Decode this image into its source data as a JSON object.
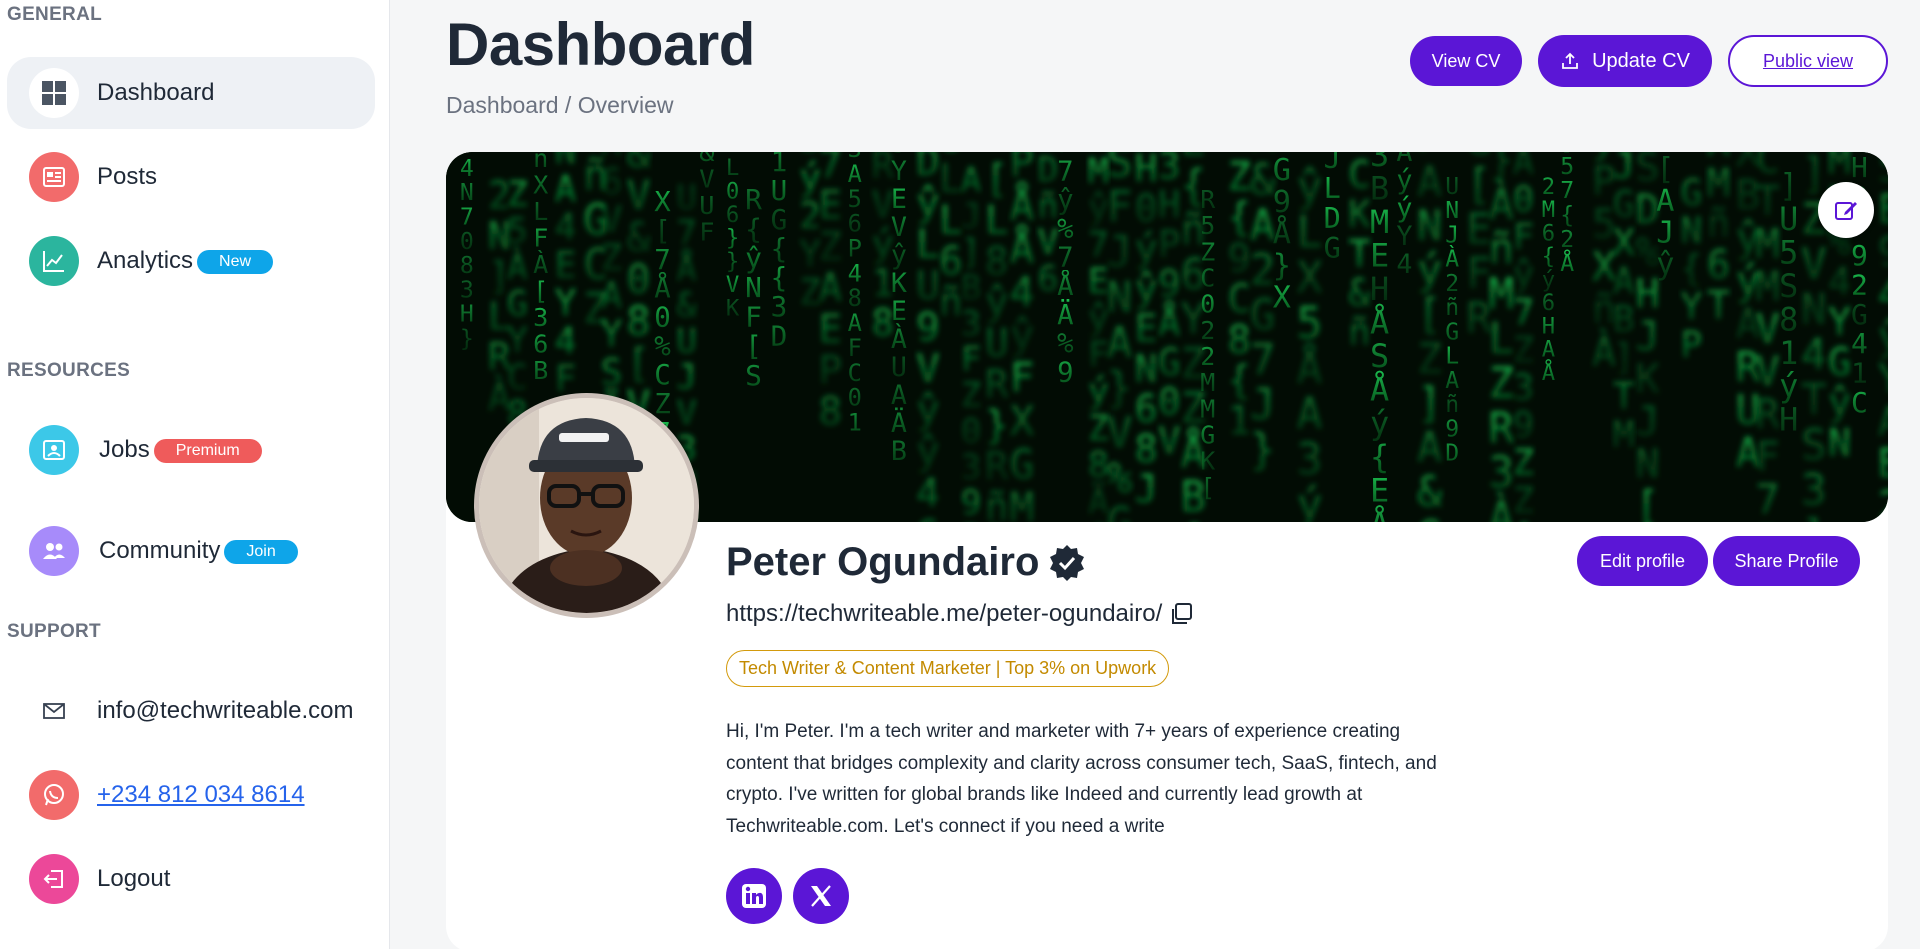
{
  "sidebar": {
    "general_title": "GENERAL",
    "resources_title": "RESOURCES",
    "support_title": "SUPPORT",
    "items": [
      {
        "label": "Dashboard",
        "icon": "dashboard-grid-icon"
      },
      {
        "label": "Posts",
        "icon": "newspaper-icon",
        "color": "#f26b6b"
      },
      {
        "label": "Analytics",
        "icon": "chart-line-icon",
        "color": "#2bb59e",
        "badge": "New",
        "badge_color": "#0ea5e9"
      },
      {
        "label": "Jobs",
        "icon": "jobs-icon",
        "color": "#3cc8e8",
        "badge": "Premium",
        "badge_color": "#ef5b5b"
      },
      {
        "label": "Community",
        "icon": "users-icon",
        "color": "#a78bfa",
        "badge": "Join",
        "badge_color": "#0ea5e9"
      },
      {
        "label": "info@techwriteable.com",
        "icon": "envelope-icon"
      },
      {
        "label": "+234 812 034 8614",
        "icon": "whatsapp-icon",
        "color": "#f26b6b"
      },
      {
        "label": "Logout",
        "icon": "logout-icon",
        "color": "#ec4899"
      }
    ]
  },
  "header": {
    "title": "Dashboard",
    "breadcrumb": "Dashboard / Overview",
    "view_cv": "View CV",
    "update_cv": "Update CV",
    "public_view": "Public view"
  },
  "profile": {
    "name": "Peter Ogundairo",
    "url": "https://techwriteable.me/peter-ogundairo/",
    "tagline": "Tech Writer & Content Marketer | Top 3% on Upwork",
    "bio": "Hi, I'm Peter. I'm a tech writer and marketer with 7+ years of experience creating content that bridges complexity and clarity across consumer tech, SaaS, fintech, and crypto. I've written for global brands like Indeed and currently lead growth at Techwriteable.com. Let's connect if you need a write",
    "edit_profile": "Edit profile",
    "share_profile": "Share Profile"
  },
  "colors": {
    "accent": "#5b16d6",
    "tagline": "#d39a0c"
  }
}
